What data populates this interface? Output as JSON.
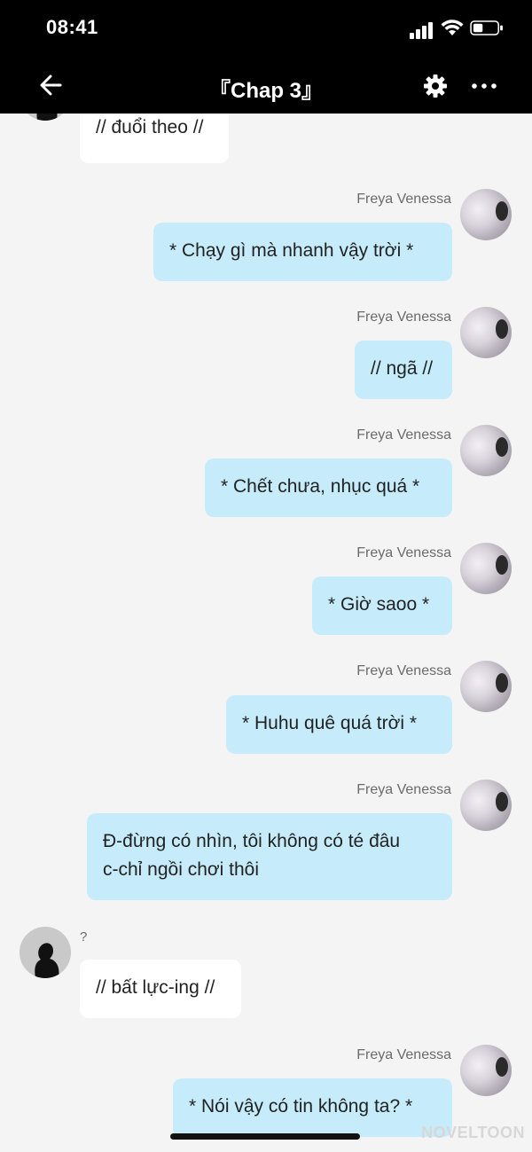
{
  "status_bar": {
    "time": "08:41"
  },
  "header": {
    "title": "『Chap 3』"
  },
  "messages": [
    {
      "side": "left",
      "text": "// đuổi theo //"
    },
    {
      "side": "right",
      "sender": "Freya Venessa",
      "text": "* Chạy gì mà nhanh vậy trời *"
    },
    {
      "side": "right",
      "sender": "Freya Venessa",
      "text": "// ngã //"
    },
    {
      "side": "right",
      "sender": "Freya Venessa",
      "text": "* Chết chưa, nhục quá *"
    },
    {
      "side": "right",
      "sender": "Freya Venessa",
      "text": "* Giờ saoo *"
    },
    {
      "side": "right",
      "sender": "Freya Venessa",
      "text": "* Huhu quê quá trời *"
    },
    {
      "side": "right",
      "sender": "Freya Venessa",
      "lines": [
        "Đ-đừng có nhìn, tôi không có té đâu",
        "c-chỉ ngồi chơi thôi"
      ]
    },
    {
      "side": "left",
      "sender": "?",
      "text": "// bất lực-ing //"
    },
    {
      "side": "right",
      "sender": "Freya Venessa",
      "text": "* Nói vậy có tin không ta? *"
    }
  ],
  "watermark": "NOVELTOON",
  "icons": {
    "back": "arrow-left-icon",
    "settings": "gear-icon",
    "more": "more-horizontal-icon",
    "signal": "signal-icon",
    "wifi": "wifi-icon",
    "battery": "battery-icon"
  },
  "colors": {
    "header_bg": "#000000",
    "right_bubble": "#c6ecfb",
    "left_bubble": "#ffffff",
    "chat_bg": "#f4f4f4"
  }
}
